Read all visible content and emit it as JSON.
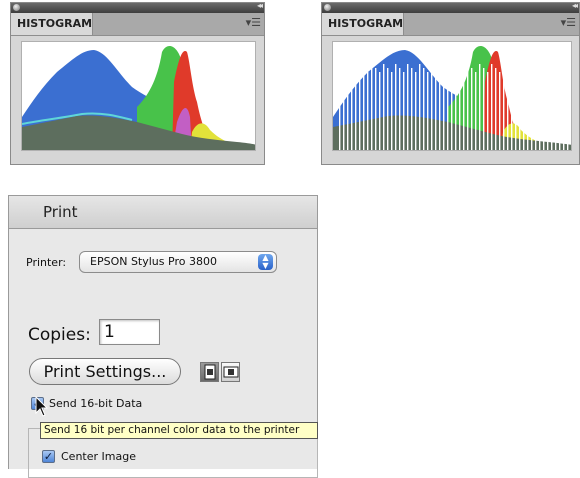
{
  "histogram_panels": [
    {
      "tab_label": "HISTOGRAM"
    },
    {
      "tab_label": "HISTOGRAM"
    }
  ],
  "print": {
    "title": "Print",
    "printer_label": "Printer:",
    "printer_value": "EPSON Stylus Pro 3800",
    "copies_label": "Copies:",
    "copies_value": "1",
    "print_settings_label": "Print Settings...",
    "send16_label": "Send 16-bit Data",
    "send16_checked": true,
    "tooltip": "Send 16 bit per channel color data to the printer",
    "center_image_label": "Center Image",
    "center_image_checked": true
  },
  "colors": {
    "accent": "#3d79d6",
    "hist_blue": "#3b6fd1",
    "hist_green": "#48c24a",
    "hist_red": "#e03a2a",
    "hist_yellow": "#e2e23a",
    "hist_magenta": "#c25fc4",
    "hist_cyan": "#5fd6d8",
    "hist_gray": "#5d6e5e",
    "tooltip_bg": "#ffffc6"
  }
}
